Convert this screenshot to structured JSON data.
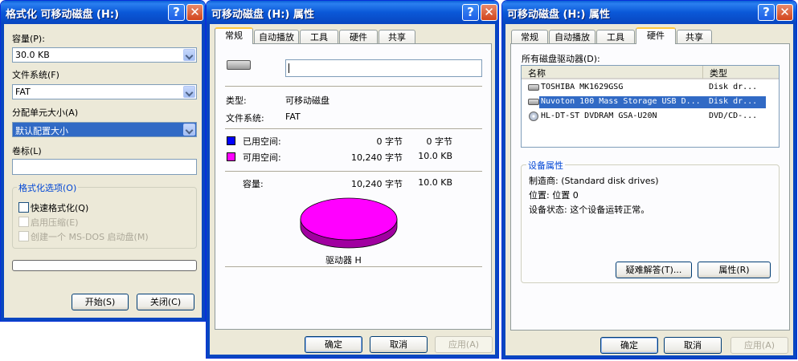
{
  "format_dialog": {
    "title": "格式化 可移动磁盘 (H:)",
    "capacity_label": "容量(P):",
    "capacity_value": "30.0 KB",
    "filesystem_label": "文件系统(F)",
    "filesystem_value": "FAT",
    "alloc_label": "分配单元大小(A)",
    "alloc_value": "默认配置大小",
    "volume_label": "卷标(L)",
    "volume_value": "",
    "options_title": "格式化选项(O)",
    "quick_format": "快速格式化(Q)",
    "compression": "启用压缩(E)",
    "msdos_disk": "创建一个 MS-DOS 启动盘(M)",
    "start_button": "开始(S)",
    "close_button": "关闭(C)"
  },
  "props_general": {
    "title": "可移动磁盘 (H:) 属性",
    "tabs": [
      "常规",
      "自动播放",
      "工具",
      "硬件",
      "共享"
    ],
    "name_value": "",
    "type_label": "类型:",
    "type_value": "可移动磁盘",
    "fs_label": "文件系统:",
    "fs_value": "FAT",
    "used_label": "已用空间:",
    "used_bytes": "0 字节",
    "used_size": "0 字节",
    "free_label": "可用空间:",
    "free_bytes": "10,240 字节",
    "free_size": "10.0 KB",
    "capacity_label": "容量:",
    "capacity_bytes": "10,240 字节",
    "capacity_size": "10.0 KB",
    "drive_label": "驱动器 H",
    "ok": "确定",
    "cancel": "取消",
    "apply": "应用(A)",
    "used_color": "#0000ff",
    "free_color": "#ff00ff"
  },
  "props_hardware": {
    "title": "可移动磁盘 (H:) 属性",
    "tabs": [
      "常规",
      "自动播放",
      "工具",
      "硬件",
      "共享"
    ],
    "all_drives_label": "所有磁盘驱动器(D):",
    "col_name": "名称",
    "col_type": "类型",
    "rows": [
      {
        "name": "TOSHIBA MK1629GSG",
        "type": "Disk dr..."
      },
      {
        "name": "Nuvoton 100 Mass Storage USB D...",
        "type": "Disk dr..."
      },
      {
        "name": "HL-DT-ST DVDRAM GSA-U20N",
        "type": "DVD/CD-..."
      }
    ],
    "device_props_title": "设备属性",
    "manufacturer": "制造商: (Standard disk drives)",
    "location": "位置: 位置 0",
    "status": "设备状态: 这个设备运转正常。",
    "troubleshoot": "疑难解答(T)...",
    "properties": "属性(R)",
    "ok": "确定",
    "cancel": "取消",
    "apply": "应用(A)"
  }
}
